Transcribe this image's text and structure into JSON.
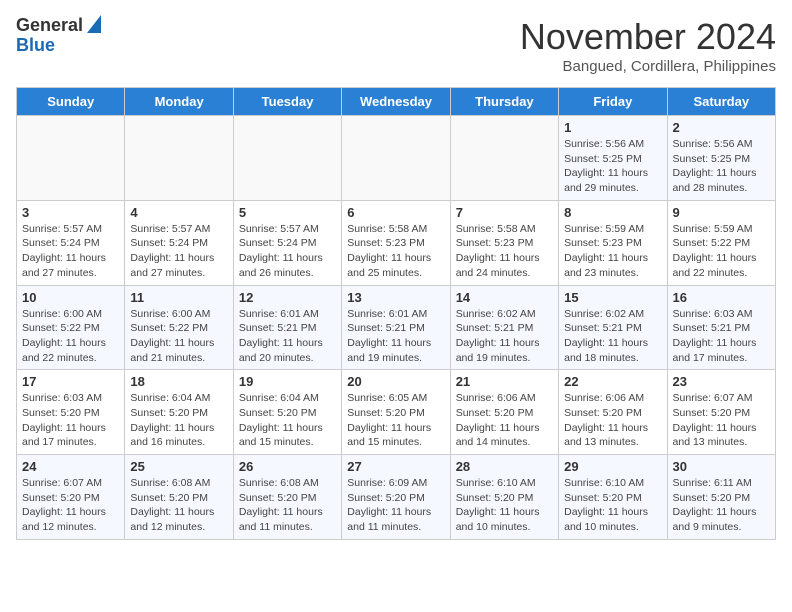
{
  "logo": {
    "line1": "General",
    "line2": "Blue"
  },
  "title": "November 2024",
  "subtitle": "Bangued, Cordillera, Philippines",
  "weekdays": [
    "Sunday",
    "Monday",
    "Tuesday",
    "Wednesday",
    "Thursday",
    "Friday",
    "Saturday"
  ],
  "weeks": [
    [
      {
        "day": "",
        "info": ""
      },
      {
        "day": "",
        "info": ""
      },
      {
        "day": "",
        "info": ""
      },
      {
        "day": "",
        "info": ""
      },
      {
        "day": "",
        "info": ""
      },
      {
        "day": "1",
        "info": "Sunrise: 5:56 AM\nSunset: 5:25 PM\nDaylight: 11 hours and 29 minutes."
      },
      {
        "day": "2",
        "info": "Sunrise: 5:56 AM\nSunset: 5:25 PM\nDaylight: 11 hours and 28 minutes."
      }
    ],
    [
      {
        "day": "3",
        "info": "Sunrise: 5:57 AM\nSunset: 5:24 PM\nDaylight: 11 hours and 27 minutes."
      },
      {
        "day": "4",
        "info": "Sunrise: 5:57 AM\nSunset: 5:24 PM\nDaylight: 11 hours and 27 minutes."
      },
      {
        "day": "5",
        "info": "Sunrise: 5:57 AM\nSunset: 5:24 PM\nDaylight: 11 hours and 26 minutes."
      },
      {
        "day": "6",
        "info": "Sunrise: 5:58 AM\nSunset: 5:23 PM\nDaylight: 11 hours and 25 minutes."
      },
      {
        "day": "7",
        "info": "Sunrise: 5:58 AM\nSunset: 5:23 PM\nDaylight: 11 hours and 24 minutes."
      },
      {
        "day": "8",
        "info": "Sunrise: 5:59 AM\nSunset: 5:23 PM\nDaylight: 11 hours and 23 minutes."
      },
      {
        "day": "9",
        "info": "Sunrise: 5:59 AM\nSunset: 5:22 PM\nDaylight: 11 hours and 22 minutes."
      }
    ],
    [
      {
        "day": "10",
        "info": "Sunrise: 6:00 AM\nSunset: 5:22 PM\nDaylight: 11 hours and 22 minutes."
      },
      {
        "day": "11",
        "info": "Sunrise: 6:00 AM\nSunset: 5:22 PM\nDaylight: 11 hours and 21 minutes."
      },
      {
        "day": "12",
        "info": "Sunrise: 6:01 AM\nSunset: 5:21 PM\nDaylight: 11 hours and 20 minutes."
      },
      {
        "day": "13",
        "info": "Sunrise: 6:01 AM\nSunset: 5:21 PM\nDaylight: 11 hours and 19 minutes."
      },
      {
        "day": "14",
        "info": "Sunrise: 6:02 AM\nSunset: 5:21 PM\nDaylight: 11 hours and 19 minutes."
      },
      {
        "day": "15",
        "info": "Sunrise: 6:02 AM\nSunset: 5:21 PM\nDaylight: 11 hours and 18 minutes."
      },
      {
        "day": "16",
        "info": "Sunrise: 6:03 AM\nSunset: 5:21 PM\nDaylight: 11 hours and 17 minutes."
      }
    ],
    [
      {
        "day": "17",
        "info": "Sunrise: 6:03 AM\nSunset: 5:20 PM\nDaylight: 11 hours and 17 minutes."
      },
      {
        "day": "18",
        "info": "Sunrise: 6:04 AM\nSunset: 5:20 PM\nDaylight: 11 hours and 16 minutes."
      },
      {
        "day": "19",
        "info": "Sunrise: 6:04 AM\nSunset: 5:20 PM\nDaylight: 11 hours and 15 minutes."
      },
      {
        "day": "20",
        "info": "Sunrise: 6:05 AM\nSunset: 5:20 PM\nDaylight: 11 hours and 15 minutes."
      },
      {
        "day": "21",
        "info": "Sunrise: 6:06 AM\nSunset: 5:20 PM\nDaylight: 11 hours and 14 minutes."
      },
      {
        "day": "22",
        "info": "Sunrise: 6:06 AM\nSunset: 5:20 PM\nDaylight: 11 hours and 13 minutes."
      },
      {
        "day": "23",
        "info": "Sunrise: 6:07 AM\nSunset: 5:20 PM\nDaylight: 11 hours and 13 minutes."
      }
    ],
    [
      {
        "day": "24",
        "info": "Sunrise: 6:07 AM\nSunset: 5:20 PM\nDaylight: 11 hours and 12 minutes."
      },
      {
        "day": "25",
        "info": "Sunrise: 6:08 AM\nSunset: 5:20 PM\nDaylight: 11 hours and 12 minutes."
      },
      {
        "day": "26",
        "info": "Sunrise: 6:08 AM\nSunset: 5:20 PM\nDaylight: 11 hours and 11 minutes."
      },
      {
        "day": "27",
        "info": "Sunrise: 6:09 AM\nSunset: 5:20 PM\nDaylight: 11 hours and 11 minutes."
      },
      {
        "day": "28",
        "info": "Sunrise: 6:10 AM\nSunset: 5:20 PM\nDaylight: 11 hours and 10 minutes."
      },
      {
        "day": "29",
        "info": "Sunrise: 6:10 AM\nSunset: 5:20 PM\nDaylight: 11 hours and 10 minutes."
      },
      {
        "day": "30",
        "info": "Sunrise: 6:11 AM\nSunset: 5:20 PM\nDaylight: 11 hours and 9 minutes."
      }
    ]
  ]
}
